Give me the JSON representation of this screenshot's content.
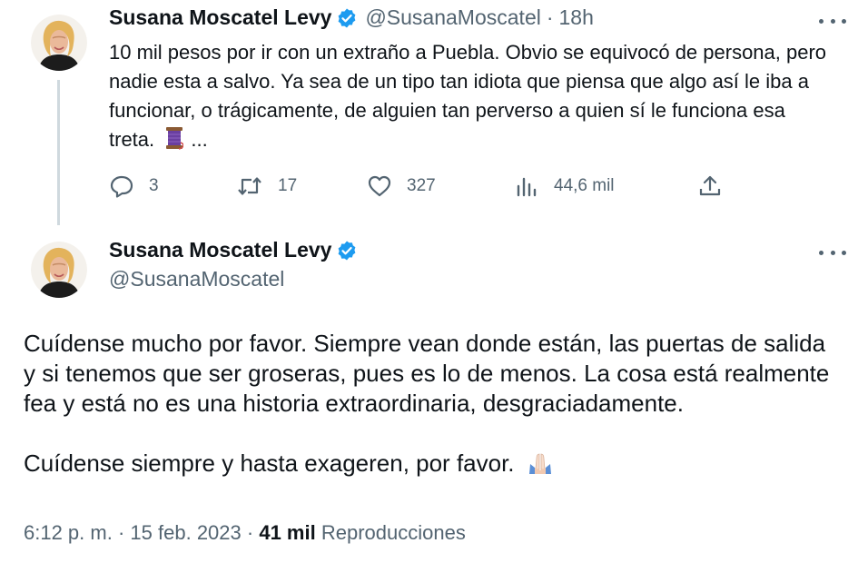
{
  "tweet1": {
    "author_name": "Susana Moscatel Levy",
    "handle": "@SusanaMoscatel",
    "separator": "·",
    "time_ago": "18h",
    "text": "10 mil pesos por ir con un extraño a Puebla. Obvio se equivocó de persona, pero nadie esta a salvo. Ya sea de un tipo tan idiota que piensa que algo así le iba a funcionar, o trágicamente, de alguien tan perverso a quien sí le funciona esa treta.",
    "truncation": "...",
    "emoji_icon": "spool-of-thread-icon",
    "actions": {
      "reply_count": "3",
      "retweet_count": "17",
      "like_count": "327",
      "views_count": "44,6 mil"
    }
  },
  "tweet2": {
    "author_name": "Susana Moscatel Levy",
    "handle": "@SusanaMoscatel",
    "paragraph1": "Cuídense mucho por favor. Siempre vean donde están, las puertas de salida y si tenemos que ser groseras, pues es lo de menos.  La cosa está realmente fea y está no es una historia extraordinaria, desgraciadamente.",
    "paragraph2": "Cuídense siempre y hasta exageren, por favor.",
    "emoji_icon": "folded-hands-icon",
    "meta": {
      "time": "6:12 p. m.",
      "sep1": "·",
      "date": "15 feb. 2023",
      "sep2": "·",
      "views_count": "41 mil",
      "views_label": "Reproducciones"
    }
  },
  "colors": {
    "text_primary": "#0f1419",
    "text_secondary": "#536471",
    "verified_blue": "#1d9bf0",
    "thread_line": "#cfd9de"
  }
}
